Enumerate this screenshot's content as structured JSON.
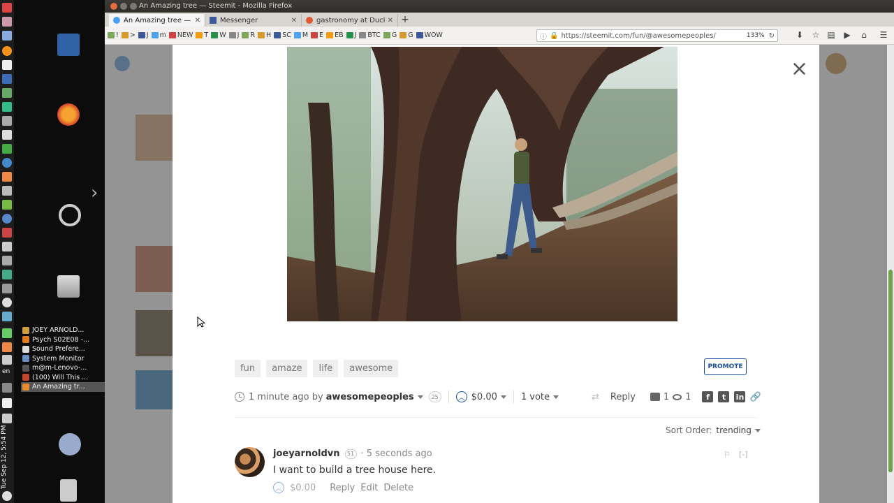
{
  "desktop": {
    "clock_text": "Tue Sep 12, 5:54 PM",
    "lang_text": "en",
    "tasks": [
      {
        "label": "JOEY ARNOLD...",
        "color": "#d0a040"
      },
      {
        "label": "Psych S02E08 -...",
        "color": "#e07b20"
      },
      {
        "label": "Sound Prefere...",
        "color": "#dddddd"
      },
      {
        "label": "System Monitor",
        "color": "#6a8fc0"
      },
      {
        "label": "m@m-Lenovo-...",
        "color": "#555555"
      },
      {
        "label": "(100) Will This ...",
        "color": "#c0462e"
      },
      {
        "label": "An Amazing tr...",
        "color": "#e68a2e"
      }
    ]
  },
  "browser": {
    "window_title": "An Amazing tree — Steemit - Mozilla Firefox",
    "tabs": [
      {
        "label": "An Amazing tree — Ste",
        "icon": "steemit-icon",
        "active": true
      },
      {
        "label": "Messenger",
        "icon": "facebook-icon",
        "active": false
      },
      {
        "label": "gastronomy at DuckD",
        "icon": "duckduckgo-icon",
        "active": false
      }
    ],
    "new_tab_label": "+",
    "bookmarks": [
      "!",
      ">",
      "J",
      "m",
      "NEW",
      "T",
      "W",
      "J",
      "R",
      "H",
      "SC",
      "M",
      "E",
      "EB",
      "J",
      "BTC",
      "G",
      "G",
      "WOW"
    ],
    "url": "https://steemit.com/fun/@awesomepeoples/",
    "zoom": "133%"
  },
  "post": {
    "tags": [
      "fun",
      "amaze",
      "life",
      "awesome"
    ],
    "promote_label": "PROMOTE",
    "time_ago": "1 minute ago by",
    "author": "awesomepeoples",
    "author_rep": "25",
    "payout": "$0.00",
    "votes": "1 vote",
    "reply_label": "Reply",
    "comment_count": "1",
    "view_count": "1",
    "close_glyph": "×"
  },
  "sort": {
    "label": "Sort Order:",
    "value": "trending"
  },
  "comment": {
    "author": "joeyarnoldvn",
    "rep": "51",
    "time": "· 5 seconds ago",
    "text": "I want to build a tree house here.",
    "payout": "$0.00",
    "reply_label": "Reply",
    "edit_label": "Edit",
    "delete_label": "Delete",
    "collapse_label": "[-]"
  },
  "colors": {
    "steemit_blue": "#1a5099",
    "scrollbar_green": "#71a24b"
  }
}
